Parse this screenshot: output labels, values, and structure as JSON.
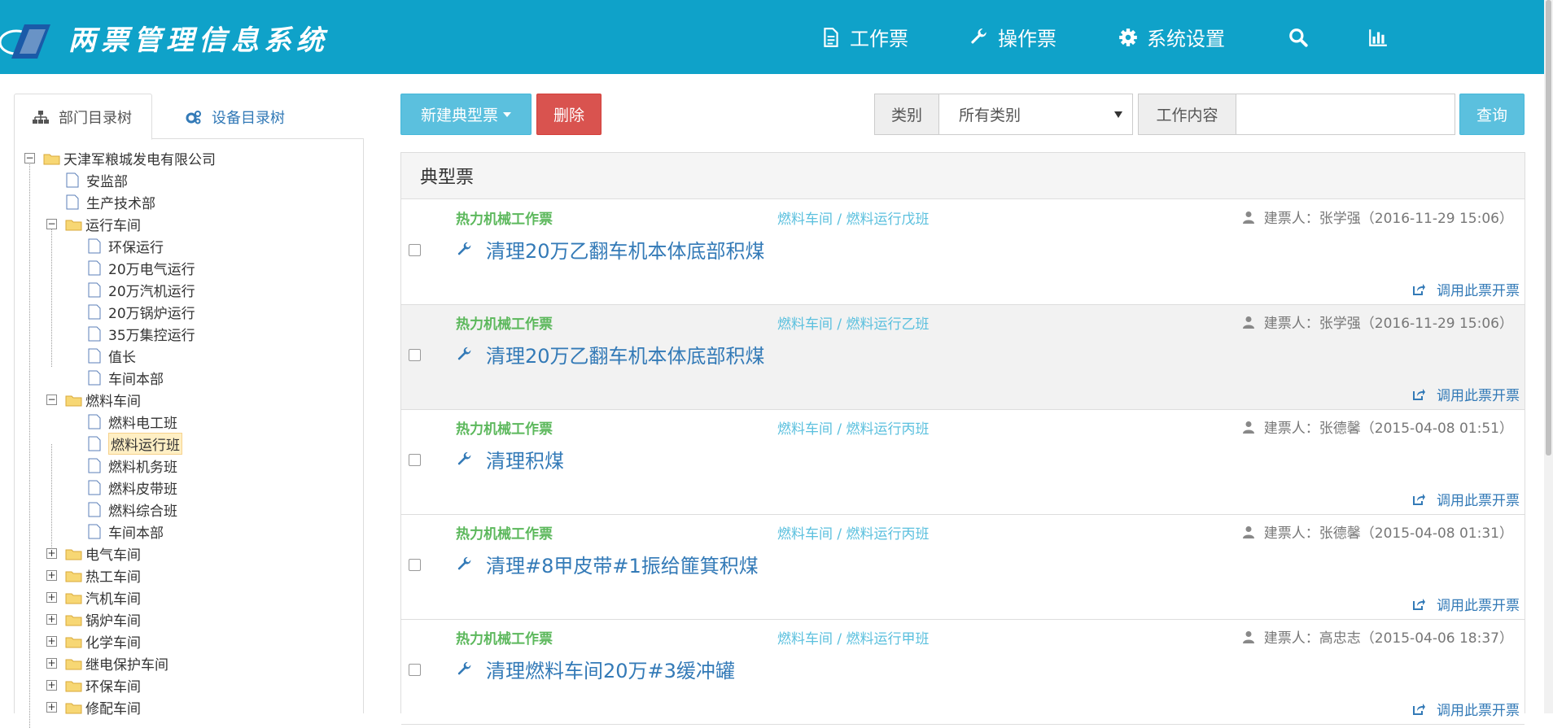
{
  "header": {
    "app_title": "两票管理信息系统",
    "nav": [
      {
        "label": "工作票",
        "icon": "file-icon"
      },
      {
        "label": "操作票",
        "icon": "wrench-icon"
      },
      {
        "label": "系统设置",
        "icon": "gear-icon"
      },
      {
        "label": "",
        "icon": "search-icon"
      },
      {
        "label": "",
        "icon": "bar-chart-icon"
      }
    ],
    "colors": {
      "bar": "#0fa2c9",
      "text": "#ffffff"
    }
  },
  "left": {
    "tabs": [
      {
        "label": "部门目录树",
        "icon": "sitemap-icon",
        "active": true
      },
      {
        "label": "设备目录树",
        "icon": "cogs-icon",
        "active": false
      }
    ],
    "tree": {
      "root": "天津军粮城发电有限公司",
      "n1": "安监部",
      "n2": "生产技术部",
      "n3": "运行车间",
      "n3_1": "环保运行",
      "n3_2": "20万电气运行",
      "n3_3": "20万汽机运行",
      "n3_4": "20万锅炉运行",
      "n3_5": "35万集控运行",
      "n3_6": "值长",
      "n3_7": "车间本部",
      "n4": "燃料车间",
      "n4_1": "燃料电工班",
      "n4_2": "燃料运行班",
      "n4_3": "燃料机务班",
      "n4_4": "燃料皮带班",
      "n4_5": "燃料综合班",
      "n4_6": "车间本部",
      "n5": "电气车间",
      "n6": "热工车间",
      "n7": "汽机车间",
      "n8": "锅炉车间",
      "n9": "化学车间",
      "n10": "继电保护车间",
      "n11": "环保车间",
      "n12": "修配车间",
      "expand_glyph": "+",
      "collapse_glyph": "−"
    }
  },
  "toolbar": {
    "new_label": "新建典型票",
    "delete_label": "删除",
    "category_addon": "类别",
    "category_selected": "所有类别",
    "content_addon": "工作内容",
    "content_value": "",
    "query_label": "查询"
  },
  "panel": {
    "heading": "典型票",
    "tickets": [
      {
        "type": "热力机械工作票",
        "dept": "燃料车间 / 燃料运行戊班",
        "creator": "建票人：张学强（2016-11-29 15:06）",
        "title": "清理20万乙翻车机本体底部积煤",
        "action": "调用此票开票"
      },
      {
        "type": "热力机械工作票",
        "dept": "燃料车间 / 燃料运行乙班",
        "creator": "建票人：张学强（2016-11-29 15:06）",
        "title": "清理20万乙翻车机本体底部积煤",
        "action": "调用此票开票"
      },
      {
        "type": "热力机械工作票",
        "dept": "燃料车间 / 燃料运行丙班",
        "creator": "建票人：张德馨（2015-04-08 01:51）",
        "title": "清理积煤",
        "action": "调用此票开票"
      },
      {
        "type": "热力机械工作票",
        "dept": "燃料车间 / 燃料运行丙班",
        "creator": "建票人：张德馨（2015-04-08 01:31）",
        "title": "清理#8甲皮带#1振给篚箕积煤",
        "action": "调用此票开票"
      },
      {
        "type": "热力机械工作票",
        "dept": "燃料车间 / 燃料运行甲班",
        "creator": "建票人：高忠志（2015-04-06 18:37）",
        "title": "清理燃料车间20万#3缓冲罐",
        "action": "调用此票开票"
      }
    ]
  }
}
